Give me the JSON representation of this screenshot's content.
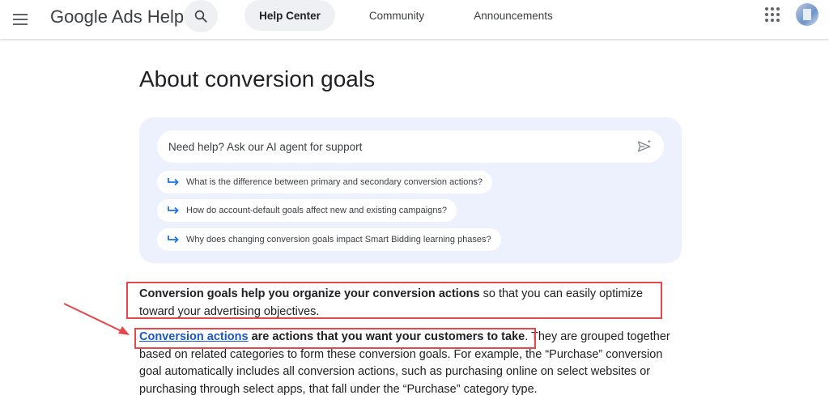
{
  "header": {
    "title": "Google Ads Help",
    "tabs": [
      {
        "label": "Help Center",
        "active": true
      },
      {
        "label": "Community",
        "active": false
      },
      {
        "label": "Announcements",
        "active": false
      }
    ],
    "icons": [
      "menu-icon",
      "search-icon",
      "apps-grid-icon",
      "avatar"
    ]
  },
  "page": {
    "title": "About conversion goals"
  },
  "ai_agent": {
    "placeholder": "Need help? Ask our AI agent for support",
    "suggestions": [
      "What is the difference between primary and secondary conversion actions?",
      "How do account-default goals affect new and existing campaigns?",
      "Why does changing conversion goals impact Smart Bidding learning phases?"
    ]
  },
  "content": {
    "p1_bold": "Conversion goals help you organize your conversion actions",
    "p1_rest": " so that you can easily optimize toward your advertising objectives.",
    "p2_link": "Conversion actions",
    "p2_bold": " are actions that you want your customers to take",
    "p2_rest": ". They are grouped together based on related categories to form these conversion goals. For example, the “Purchase” conversion goal automatically includes all conversion actions, such as purchasing online on select websites or purchasing through select apps, that fall under the “Purchase” category type."
  },
  "colors": {
    "accent": "#1a56c8",
    "annotation": "#e5474a",
    "card_bg": "#edf1fd"
  }
}
